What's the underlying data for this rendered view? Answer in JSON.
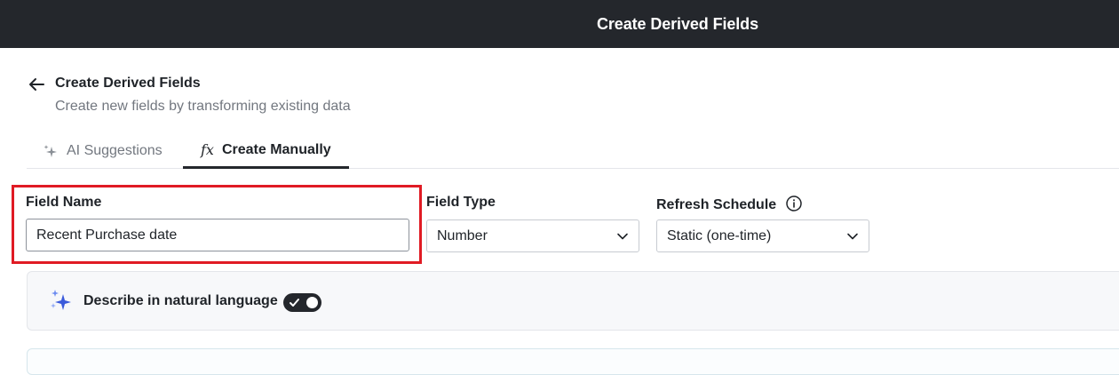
{
  "topbar": {
    "title": "Create Derived Fields"
  },
  "header": {
    "title": "Create Derived Fields",
    "subtitle": "Create new fields by transforming existing data",
    "back_icon": "arrow-left-icon"
  },
  "tabs": [
    {
      "label": "AI Suggestions",
      "icon": "sparkle-icon",
      "active": false
    },
    {
      "label": "Create Manually",
      "icon": "fx-icon",
      "icon_text": "fx",
      "active": true
    }
  ],
  "form": {
    "field_name": {
      "label": "Field Name",
      "value": "Recent Purchase date"
    },
    "field_type": {
      "label": "Field Type",
      "value": "Number"
    },
    "refresh_schedule": {
      "label": "Refresh Schedule",
      "value": "Static (one-time)",
      "info_icon": "info-icon"
    }
  },
  "natural_language": {
    "label": "Describe in natural language",
    "toggle_on": true,
    "icon": "sparkle-icon"
  },
  "colors": {
    "topbar_bg": "#24272c",
    "highlight": "#e01b24",
    "sparkle_blue": "#3b5bdb"
  }
}
